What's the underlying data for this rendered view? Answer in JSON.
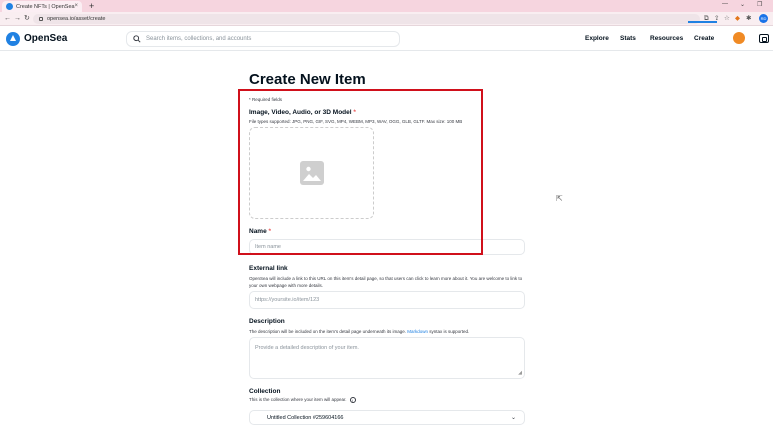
{
  "browser": {
    "tab_title": "Create NFTs | OpenSea",
    "tab_close": "×",
    "new_tab": "+",
    "url": "opensea.io/asset/create",
    "window_controls": [
      "—",
      "⌄",
      "❐"
    ],
    "profile_initials": "RD"
  },
  "header": {
    "brand": "OpenSea",
    "search_placeholder": "Search items, collections, and accounts",
    "nav": [
      "Explore",
      "Stats",
      "Resources",
      "Create"
    ]
  },
  "form": {
    "title": "Create New Item",
    "required_note": "* Required fields",
    "media_label": "Image, Video, Audio, or 3D Model",
    "media_hint": "File types supported: JPG, PNG, GIF, SVG, MP4, WEBM, MP3, WAV, OGG, GLB, GLTF. Max size: 100 MB",
    "name_label": "Name",
    "name_placeholder": "Item name",
    "external_link_label": "External link",
    "external_link_hint": "OpenSea will include a link to this URL on this item's detail page, so that users can click to learn more about it. You are welcome to link to your own webpage with more details.",
    "external_link_placeholder": "https://yoursite.io/item/123",
    "description_label": "Description",
    "description_hint_before": "The description will be included on the item's detail page underneath its image.",
    "description_hint_link": "Markdown",
    "description_hint_after": "syntax is supported.",
    "description_placeholder": "Provide a detailed description of your item.",
    "collection_label": "Collection",
    "collection_hint": "This is the collection where your item will appear.",
    "collection_info": "i",
    "collection_value": "Untitled Collection #259604166"
  },
  "colors": {
    "accent": "#2081e2",
    "highlight": "#d0101b",
    "required": "#eb5757"
  }
}
